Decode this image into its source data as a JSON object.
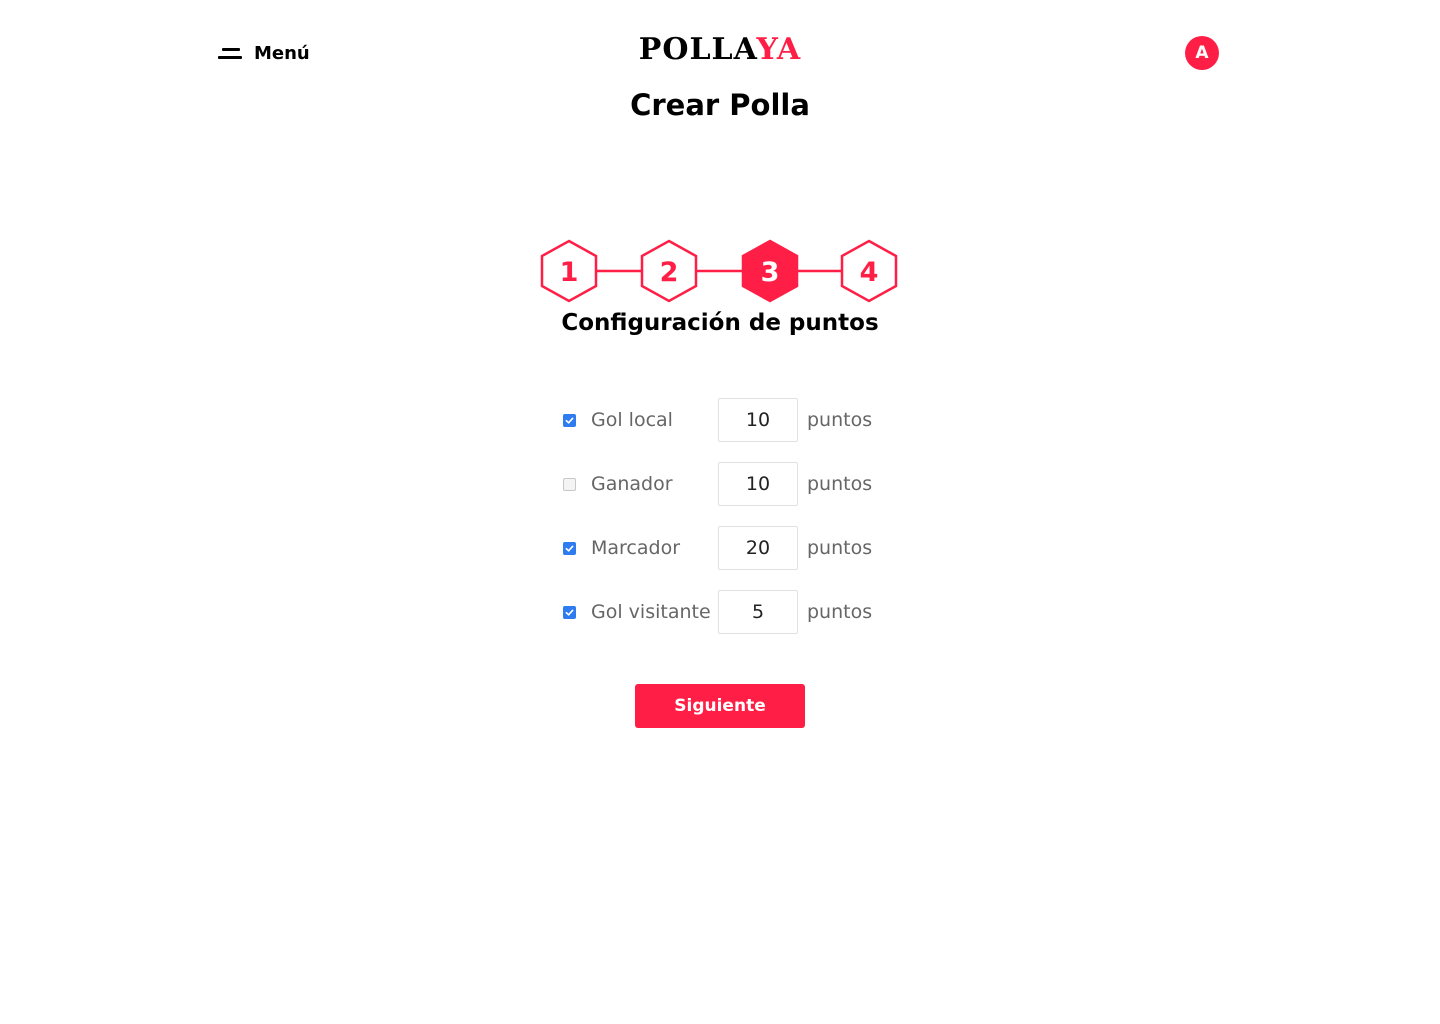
{
  "header": {
    "menu_label": "Menú",
    "logo_part1": "POLLA",
    "logo_part2": "YA",
    "avatar_initial": "A"
  },
  "page_title": "Crear Polla",
  "stepper": {
    "steps": [
      "1",
      "2",
      "3",
      "4"
    ],
    "active_step": 3
  },
  "section_title": "Configuración de puntos",
  "options": [
    {
      "label": "Gol local",
      "checked": true,
      "value": "10",
      "unit": "puntos"
    },
    {
      "label": "Ganador",
      "checked": false,
      "value": "10",
      "unit": "puntos"
    },
    {
      "label": "Marcador",
      "checked": true,
      "value": "20",
      "unit": "puntos"
    },
    {
      "label": "Gol visitante",
      "checked": true,
      "value": "5",
      "unit": "puntos"
    }
  ],
  "next_button": "Siguiente",
  "colors": {
    "accent": "#ff1f46",
    "checkbox": "#2f7bf0"
  }
}
